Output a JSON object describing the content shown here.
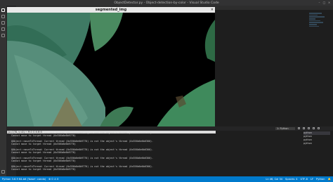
{
  "window": {
    "title": "ObjectDetector.py - Object-detection-by-color - Visual Studio Code"
  },
  "cv_window": {
    "title": "segmented_img",
    "close": "×",
    "status": "(x=178, y=0) ~ R:0 G:0 B:0"
  },
  "panel": {
    "dropdown": "1: Python"
  },
  "terminal": {
    "lines": [
      "QObject::moveToThread: Current thread (0x556b6e6b9770) is not the object's thread (0x556b6e6b6300).",
      "Cannot move to target thread (0x556b6e6b9770)",
      "",
      "QObject::moveToThread: Current thread (0x556b6e6b9770) is not the object's thread (0x556b6e6b6300).",
      "Cannot move to target thread (0x556b6e6b9770)",
      "",
      "QObject::moveToThread: Current thread (0x556b6e6b9770) is not the object's thread (0x556b6e6b6300).",
      "Cannot move to target thread (0x556b6e6b9770)",
      "",
      "QObject::moveToThread: Current thread (0x556b6e6b9770) is not the object's thread (0x556b6e6b6300).",
      "Cannot move to target thread (0x556b6e6b9770)",
      "",
      "QObject::moveToThread: Current thread (0x556b6e6b9770) is not the object's thread (0x556b6e6b6300).",
      "Cannot move to target thread (0x556b6e6b9770)",
      "",
      "",
      ""
    ],
    "sessions": [
      "python",
      "python",
      "python",
      "python"
    ]
  },
  "statusbar": {
    "python": "Python 3.6.9 64-bit ('base': conda)",
    "problems": "⊗ 0  ⚠ 0",
    "position": "Ln 46, Col 34",
    "spaces": "Spaces: 4",
    "encoding": "UTF-8",
    "eol": "LF",
    "language": "Python"
  },
  "colors": {
    "statusbar": "#007acc",
    "editor_bg": "#1e1e1e",
    "panel_bg": "#252526"
  },
  "icons": [
    "explorer-icon",
    "search-icon",
    "source-control-icon",
    "debug-icon",
    "extensions-icon",
    "settings-icon"
  ]
}
